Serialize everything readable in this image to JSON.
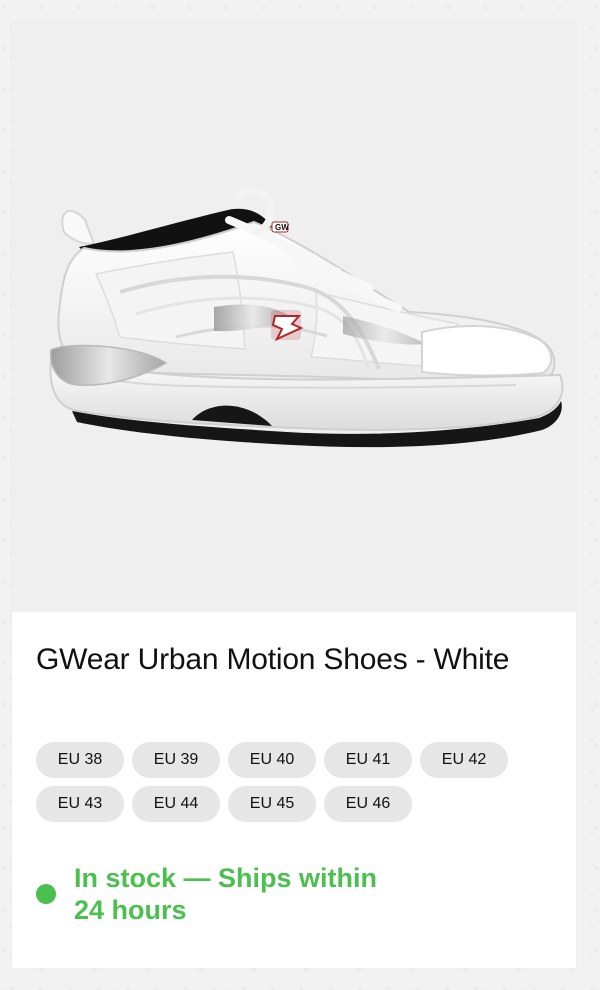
{
  "product": {
    "title": "GWear Urban Motion Shoes - White",
    "image_icon": "shoe-image",
    "brand_mark": "GW"
  },
  "sizes": [
    {
      "label": "EU 38"
    },
    {
      "label": "EU 39"
    },
    {
      "label": "EU 40"
    },
    {
      "label": "EU 41"
    },
    {
      "label": "EU 42"
    },
    {
      "label": "EU 43"
    },
    {
      "label": "EU 44"
    },
    {
      "label": "EU 45"
    },
    {
      "label": "EU 46"
    }
  ],
  "stock": {
    "text": "In stock — Ships within 24 hours",
    "color": "#4bbf4f"
  },
  "colors": {
    "image_background": "#efefef",
    "chip_background": "#e6e6e6",
    "logo_red": "#b3262d"
  }
}
